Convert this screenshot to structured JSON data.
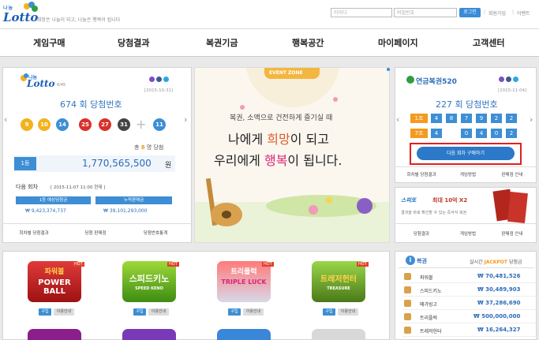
{
  "header": {
    "logo_small": "나눔",
    "logo_big": "Lotto",
    "slogan": "희망은 나눌이 되고, 나눔은 행복이 됩니다",
    "id_placeholder": "아이디",
    "pw_placeholder": "비밀번호",
    "login": "로그인",
    "join": "회원가입",
    "event": "이벤트",
    "sep": "|"
  },
  "nav": [
    "게임구매",
    "당첨결과",
    "복권기금",
    "행복공간",
    "마이페이지",
    "고객센터"
  ],
  "lotto": {
    "logo_small": "나눔",
    "logo_big": "Lotto",
    "logo_sub": "6/45",
    "date": "[2015-10-31]",
    "round": "674 회 당첨번호",
    "balls": [
      "9",
      "10",
      "14",
      "25",
      "27",
      "31"
    ],
    "bonus": "11",
    "plus": "+",
    "winners_pre": "총",
    "winners_num": "8",
    "winners_post": "명 당첨",
    "rank": "1등",
    "amount": "1,770,565,500",
    "won": "원",
    "next_label": "다음 회차",
    "next_date": "[ 2015-11-07 11:00 현재 ]",
    "expected_label": "1등 예상당첨금",
    "expected_value": "₩ 9,423,374,737",
    "sales_label": "누적판매금",
    "sales_value": "₩ 39,101,293,000",
    "tabs": [
      "회차별 당첨결과",
      "당첨 판매점",
      "당첨번호통계"
    ],
    "arrow_left": "‹",
    "arrow_right": "›"
  },
  "banner": {
    "zone": "EVENT ZONE",
    "line1": "복권, 소액으로 건전하게 즐기실 때",
    "line2_pre": "나에게 ",
    "line2_hl": "희망",
    "line2_post": "이 되고",
    "line3_pre": "우리에게 ",
    "line3_hl": "행복",
    "line3_post": "이 됩니다."
  },
  "pension": {
    "logo": "연금복권520",
    "date": "[2015-11-04]",
    "round": "227 회 당첨번호",
    "row1_label": "1조",
    "row1": [
      "4",
      "8",
      "7",
      "9",
      "2",
      "2"
    ],
    "row2_label": "7조",
    "row2": [
      "4",
      "0",
      "4",
      "0",
      "2"
    ],
    "buy_button": "다음 회차 구매하기",
    "tabs": [
      "회차별 당첨결과",
      "게임방법",
      "판매점 안내"
    ]
  },
  "speetto": {
    "logo": "스피또",
    "text1": "최대 10억 X2",
    "text2": "결과을 바로 확인할 수 있는 즉석식 복권",
    "tabs": [
      "당첨결과",
      "게임방법",
      "판매점 안내"
    ]
  },
  "games": [
    {
      "title": "파워볼",
      "sub": "POWER BALL",
      "buy": "구입",
      "guide": "이용안내",
      "hot": "HOT"
    },
    {
      "title": "스피드키노",
      "sub": "SPEED KENO",
      "buy": "구입",
      "guide": "이용안내",
      "hot": "HOT"
    },
    {
      "title": "트리플럭",
      "sub": "TRIPLE LUCK",
      "buy": "구입",
      "guide": "이용안내",
      "hot": "HOT"
    },
    {
      "title": "트레저헌터",
      "sub": "TREASURE",
      "buy": "구입",
      "guide": "이용안내",
      "hot": "HOT"
    }
  ],
  "ilotto": {
    "logo": "복권",
    "header_pre": "실시간",
    "header_hl": "JACKPOT",
    "header_post": "당첨금",
    "rows": [
      {
        "name": "파워볼",
        "value": "₩ 70,481,526"
      },
      {
        "name": "스피드키노",
        "value": "₩ 30,489,903"
      },
      {
        "name": "메가빙고",
        "value": "₩ 37,286,690"
      },
      {
        "name": "트리플럭",
        "value": "₩ 500,000,000"
      },
      {
        "name": "트레저헌터",
        "value": "₩ 16,264,327"
      }
    ]
  },
  "colors": {
    "accent": "#3d8ed4",
    "red": "#d9312a",
    "orange": "#f39a1f",
    "green": "#2f9e44"
  }
}
